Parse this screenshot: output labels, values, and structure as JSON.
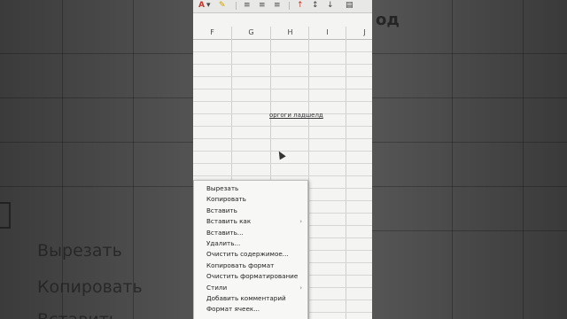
{
  "background": {
    "left_menu_items": [
      "Вырезать",
      "Копировать",
      "Вставить"
    ],
    "right_fragment": "од"
  },
  "toolbar": {
    "buttons": [
      "A",
      "▾",
      "✎",
      "≡",
      "≡",
      "≡",
      "↑",
      "↕",
      "↓",
      "▤"
    ]
  },
  "sheet": {
    "columns": [
      "F",
      "G",
      "H",
      "I",
      "J"
    ],
    "cell_text": "оргоги ладшелд"
  },
  "context_menu": {
    "items": [
      {
        "label": "Вырезать",
        "submenu": false
      },
      {
        "label": "Копировать",
        "submenu": false
      },
      {
        "label": "Вставить",
        "submenu": false
      },
      {
        "label": "Вставить как",
        "submenu": true
      },
      {
        "label": "Вставить...",
        "submenu": false
      },
      {
        "label": "Удалить...",
        "submenu": false
      },
      {
        "label": "Очистить содержимое...",
        "submenu": false
      },
      {
        "label": "Копировать формат",
        "submenu": false
      },
      {
        "label": "Очистить форматирование",
        "submenu": false
      },
      {
        "label": "Стили",
        "submenu": true
      },
      {
        "label": "Добавить комментарий",
        "submenu": false
      },
      {
        "label": "Формат ячеек...",
        "submenu": false
      }
    ],
    "submenu_arrow": "›"
  }
}
